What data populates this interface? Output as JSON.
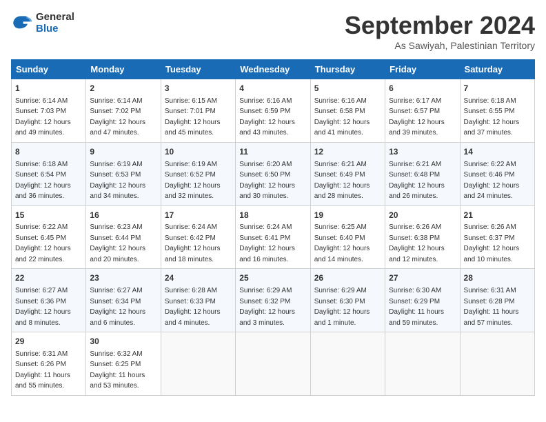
{
  "logo": {
    "general": "General",
    "blue": "Blue"
  },
  "header": {
    "month": "September 2024",
    "location": "As Sawiyah, Palestinian Territory"
  },
  "weekdays": [
    "Sunday",
    "Monday",
    "Tuesday",
    "Wednesday",
    "Thursday",
    "Friday",
    "Saturday"
  ],
  "weeks": [
    [
      {
        "day": "1",
        "sunrise": "6:14 AM",
        "sunset": "7:03 PM",
        "daylight": "12 hours and 49 minutes."
      },
      {
        "day": "2",
        "sunrise": "6:14 AM",
        "sunset": "7:02 PM",
        "daylight": "12 hours and 47 minutes."
      },
      {
        "day": "3",
        "sunrise": "6:15 AM",
        "sunset": "7:01 PM",
        "daylight": "12 hours and 45 minutes."
      },
      {
        "day": "4",
        "sunrise": "6:16 AM",
        "sunset": "6:59 PM",
        "daylight": "12 hours and 43 minutes."
      },
      {
        "day": "5",
        "sunrise": "6:16 AM",
        "sunset": "6:58 PM",
        "daylight": "12 hours and 41 minutes."
      },
      {
        "day": "6",
        "sunrise": "6:17 AM",
        "sunset": "6:57 PM",
        "daylight": "12 hours and 39 minutes."
      },
      {
        "day": "7",
        "sunrise": "6:18 AM",
        "sunset": "6:55 PM",
        "daylight": "12 hours and 37 minutes."
      }
    ],
    [
      {
        "day": "8",
        "sunrise": "6:18 AM",
        "sunset": "6:54 PM",
        "daylight": "12 hours and 36 minutes."
      },
      {
        "day": "9",
        "sunrise": "6:19 AM",
        "sunset": "6:53 PM",
        "daylight": "12 hours and 34 minutes."
      },
      {
        "day": "10",
        "sunrise": "6:19 AM",
        "sunset": "6:52 PM",
        "daylight": "12 hours and 32 minutes."
      },
      {
        "day": "11",
        "sunrise": "6:20 AM",
        "sunset": "6:50 PM",
        "daylight": "12 hours and 30 minutes."
      },
      {
        "day": "12",
        "sunrise": "6:21 AM",
        "sunset": "6:49 PM",
        "daylight": "12 hours and 28 minutes."
      },
      {
        "day": "13",
        "sunrise": "6:21 AM",
        "sunset": "6:48 PM",
        "daylight": "12 hours and 26 minutes."
      },
      {
        "day": "14",
        "sunrise": "6:22 AM",
        "sunset": "6:46 PM",
        "daylight": "12 hours and 24 minutes."
      }
    ],
    [
      {
        "day": "15",
        "sunrise": "6:22 AM",
        "sunset": "6:45 PM",
        "daylight": "12 hours and 22 minutes."
      },
      {
        "day": "16",
        "sunrise": "6:23 AM",
        "sunset": "6:44 PM",
        "daylight": "12 hours and 20 minutes."
      },
      {
        "day": "17",
        "sunrise": "6:24 AM",
        "sunset": "6:42 PM",
        "daylight": "12 hours and 18 minutes."
      },
      {
        "day": "18",
        "sunrise": "6:24 AM",
        "sunset": "6:41 PM",
        "daylight": "12 hours and 16 minutes."
      },
      {
        "day": "19",
        "sunrise": "6:25 AM",
        "sunset": "6:40 PM",
        "daylight": "12 hours and 14 minutes."
      },
      {
        "day": "20",
        "sunrise": "6:26 AM",
        "sunset": "6:38 PM",
        "daylight": "12 hours and 12 minutes."
      },
      {
        "day": "21",
        "sunrise": "6:26 AM",
        "sunset": "6:37 PM",
        "daylight": "12 hours and 10 minutes."
      }
    ],
    [
      {
        "day": "22",
        "sunrise": "6:27 AM",
        "sunset": "6:36 PM",
        "daylight": "12 hours and 8 minutes."
      },
      {
        "day": "23",
        "sunrise": "6:27 AM",
        "sunset": "6:34 PM",
        "daylight": "12 hours and 6 minutes."
      },
      {
        "day": "24",
        "sunrise": "6:28 AM",
        "sunset": "6:33 PM",
        "daylight": "12 hours and 4 minutes."
      },
      {
        "day": "25",
        "sunrise": "6:29 AM",
        "sunset": "6:32 PM",
        "daylight": "12 hours and 3 minutes."
      },
      {
        "day": "26",
        "sunrise": "6:29 AM",
        "sunset": "6:30 PM",
        "daylight": "12 hours and 1 minute."
      },
      {
        "day": "27",
        "sunrise": "6:30 AM",
        "sunset": "6:29 PM",
        "daylight": "11 hours and 59 minutes."
      },
      {
        "day": "28",
        "sunrise": "6:31 AM",
        "sunset": "6:28 PM",
        "daylight": "11 hours and 57 minutes."
      }
    ],
    [
      {
        "day": "29",
        "sunrise": "6:31 AM",
        "sunset": "6:26 PM",
        "daylight": "11 hours and 55 minutes."
      },
      {
        "day": "30",
        "sunrise": "6:32 AM",
        "sunset": "6:25 PM",
        "daylight": "11 hours and 53 minutes."
      },
      null,
      null,
      null,
      null,
      null
    ]
  ]
}
